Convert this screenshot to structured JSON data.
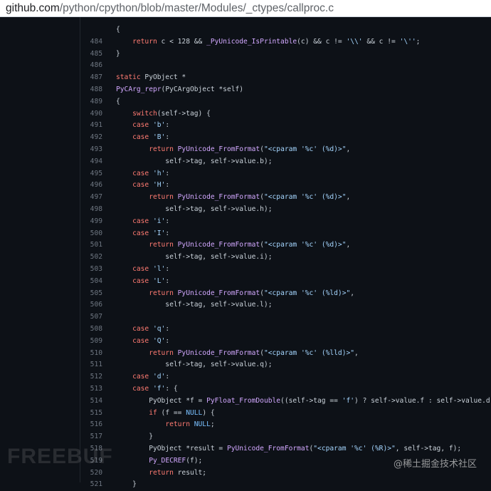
{
  "url": {
    "host": "github.com",
    "path": "/python/cpython/blob/master/Modules/_ctypes/callproc.c"
  },
  "code_lines": [
    {
      "n": "",
      "text": "{"
    },
    {
      "n": "484",
      "text": "    return c < 128 && _PyUnicode_IsPrintable(c) && c != '\\\\' && c != '\\'';"
    },
    {
      "n": "485",
      "text": "}"
    },
    {
      "n": "486",
      "text": ""
    },
    {
      "n": "487",
      "text": "static PyObject *"
    },
    {
      "n": "488",
      "text": "PyCArg_repr(PyCArgObject *self)"
    },
    {
      "n": "489",
      "text": "{"
    },
    {
      "n": "490",
      "text": "    switch(self->tag) {"
    },
    {
      "n": "491",
      "text": "    case 'b':"
    },
    {
      "n": "492",
      "text": "    case 'B':"
    },
    {
      "n": "493",
      "text": "        return PyUnicode_FromFormat(\"<cparam '%c' (%d)>\","
    },
    {
      "n": "494",
      "text": "            self->tag, self->value.b);"
    },
    {
      "n": "495",
      "text": "    case 'h':"
    },
    {
      "n": "496",
      "text": "    case 'H':"
    },
    {
      "n": "497",
      "text": "        return PyUnicode_FromFormat(\"<cparam '%c' (%d)>\","
    },
    {
      "n": "498",
      "text": "            self->tag, self->value.h);"
    },
    {
      "n": "499",
      "text": "    case 'i':"
    },
    {
      "n": "500",
      "text": "    case 'I':"
    },
    {
      "n": "501",
      "text": "        return PyUnicode_FromFormat(\"<cparam '%c' (%d)>\","
    },
    {
      "n": "502",
      "text": "            self->tag, self->value.i);"
    },
    {
      "n": "503",
      "text": "    case 'l':"
    },
    {
      "n": "504",
      "text": "    case 'L':"
    },
    {
      "n": "505",
      "text": "        return PyUnicode_FromFormat(\"<cparam '%c' (%ld)>\","
    },
    {
      "n": "506",
      "text": "            self->tag, self->value.l);"
    },
    {
      "n": "507",
      "text": ""
    },
    {
      "n": "508",
      "text": "    case 'q':"
    },
    {
      "n": "509",
      "text": "    case 'Q':"
    },
    {
      "n": "510",
      "text": "        return PyUnicode_FromFormat(\"<cparam '%c' (%lld)>\","
    },
    {
      "n": "511",
      "text": "            self->tag, self->value.q);"
    },
    {
      "n": "512",
      "text": "    case 'd':"
    },
    {
      "n": "513",
      "text": "    case 'f': {"
    },
    {
      "n": "514",
      "text": "        PyObject *f = PyFloat_FromDouble((self->tag == 'f') ? self->value.f : self->value.d);"
    },
    {
      "n": "515",
      "text": "        if (f == NULL) {"
    },
    {
      "n": "516",
      "text": "            return NULL;"
    },
    {
      "n": "517",
      "text": "        }"
    },
    {
      "n": "518",
      "text": "        PyObject *result = PyUnicode_FromFormat(\"<cparam '%c' (%R)>\", self->tag, f);"
    },
    {
      "n": "519",
      "text": "        Py_DECREF(f);"
    },
    {
      "n": "520",
      "text": "        return result;"
    },
    {
      "n": "521",
      "text": "    }"
    }
  ],
  "watermarks": {
    "left": "FREEBUF",
    "right": "@稀土掘金技术社区"
  },
  "colors": {
    "background": "#0d1117",
    "keyword": "#ff7b72",
    "function": "#d2a8ff",
    "string": "#a5d6ff",
    "constant": "#79c0ff",
    "line_number": "#6e7681"
  }
}
